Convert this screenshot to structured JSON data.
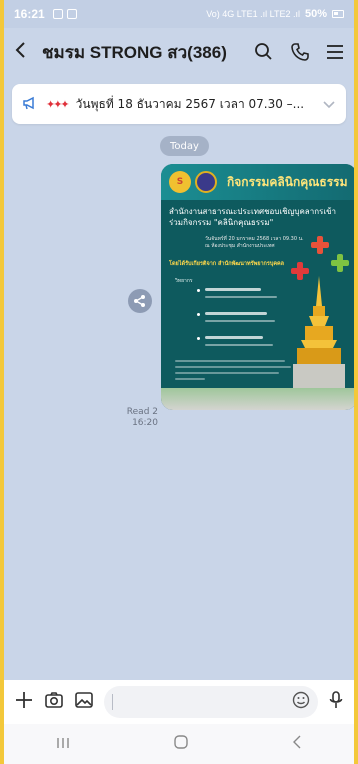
{
  "status_bar": {
    "time": "16:21",
    "network_text": "Vo) 4G LTE1 .ıl LTE2 .ıl",
    "battery": "50%"
  },
  "header": {
    "title": "ชมรม STRONG สว(386)",
    "icons": [
      "back-icon",
      "search-icon",
      "phone-icon",
      "menu-icon"
    ]
  },
  "announcement": {
    "text": "วันพุธที่ 18 ธันวาคม 2567 เวลา 07.30 –..."
  },
  "chat": {
    "date_label": "Today",
    "message": {
      "read_status": "Read 2",
      "time": "16:20",
      "image": {
        "banner_title": "กิจกรรมคลินิกคุณธรรม",
        "heading": "สำนักงานสาธารณะประเทศชอบเชิญบุคลากรเข้าร่วมกิจกรรม \"คลินิกคุณธรรม\"",
        "date_line": "วันจันทร์ที่ 20 มกราคม 2568 เวลา 09.30 น. ณ ห้องประชุม สำนักงานประเทศ",
        "org_line": "โดยได้รับเกียรติจาก สำนักพัฒนาทรัพยากรบุคคล",
        "speakers_label": "วิทยากร",
        "logo_text": "S"
      }
    }
  },
  "input": {
    "placeholder": ""
  },
  "colors": {
    "chat_bg": "#c9d5e8",
    "frame": "#f3c83a",
    "poster_bg": "#0e5a5e",
    "banner_title": "#ffe57a"
  }
}
